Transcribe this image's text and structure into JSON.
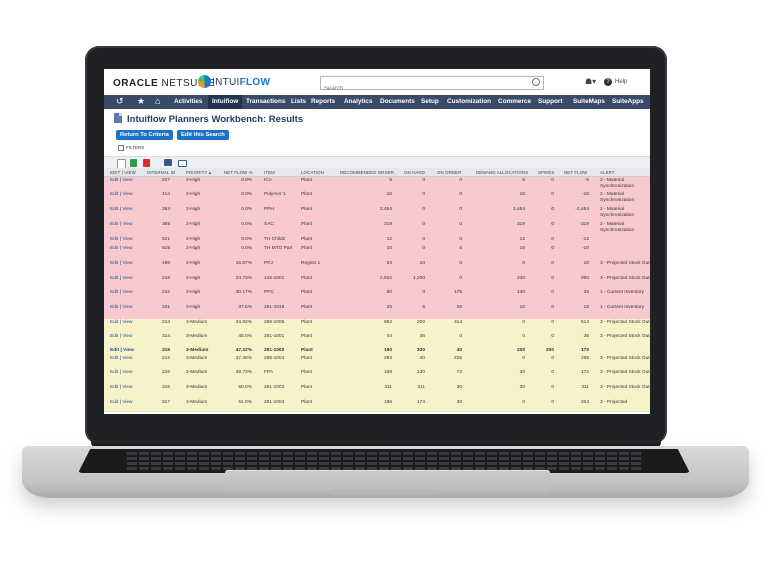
{
  "header": {
    "oracle_logo": "ORACLE",
    "netsuite_logo": "NETSUITE",
    "intuiflow_logo_a": "INTUI",
    "intuiflow_logo_b": "FLOW",
    "search_placeholder": "Search",
    "help_label": "Help"
  },
  "nav": {
    "items": [
      "Activities",
      "Intuiflow",
      "Transactions",
      "Lists",
      "Reports",
      "Analytics",
      "Documents",
      "Setup",
      "Customization",
      "Commerce",
      "Support",
      "SuiteMaps",
      "SuiteApps"
    ],
    "active": "Intuiflow"
  },
  "page": {
    "title": "Intuiflow Planners Workbench: Results",
    "return_button": "Return To Criteria",
    "edit_button": "Edit this Search",
    "filters_label": "FILTERS"
  },
  "table": {
    "columns": [
      "EDIT | VIEW",
      "INTERNAL ID",
      "PRIORITY ▴",
      "NET FLOW %",
      "ITEM",
      "LOCATION",
      "RECOMMENDED ORDER",
      "ON HAND",
      "ON ORDER",
      "DEMAND ALLOCATIONS",
      "SPIKES",
      "NET FLOW",
      "ALERT"
    ],
    "rows": [
      {
        "id": "227",
        "priority": "2-High",
        "nfp": "0.0%",
        "item": "ICA",
        "location": "Plant",
        "rec": "5",
        "onhand": "0",
        "onorder": "0",
        "demand": "5",
        "spikes": "0",
        "netflow": "-5",
        "alert": "2 - Material Synchronization",
        "color": "red",
        "bold": false,
        "h": 14
      },
      {
        "id": "414",
        "priority": "2-High",
        "nfp": "0.0%",
        "item": "Polymer 1",
        "location": "Plant",
        "rec": "10",
        "onhand": "0",
        "onorder": "0",
        "demand": "10",
        "spikes": "0",
        "netflow": "-10",
        "alert": "2 - Material Synchronization",
        "color": "red",
        "bold": false,
        "h": 15
      },
      {
        "id": "384",
        "priority": "2-High",
        "nfp": "0.0%",
        "item": "PPH",
        "location": "Plant",
        "rec": "2,464",
        "onhand": "0",
        "onorder": "0",
        "demand": "2,464",
        "spikes": "0",
        "netflow": "-2,464",
        "alert": "2 - Material Synchronization",
        "color": "red",
        "bold": false,
        "h": 15
      },
      {
        "id": "369",
        "priority": "2-High",
        "nfp": "0.0%",
        "item": "SAC",
        "location": "Plant",
        "rec": "319",
        "onhand": "0",
        "onorder": "0",
        "demand": "319",
        "spikes": "0",
        "netflow": "-319",
        "alert": "2 - Material Synchronization",
        "color": "red",
        "bold": false,
        "h": 15
      },
      {
        "id": "521",
        "priority": "2-High",
        "nfp": "0.0%",
        "item": "TH Child2",
        "location": "Plant",
        "rec": "12",
        "onhand": "0",
        "onorder": "0",
        "demand": "12",
        "spikes": "0",
        "netflow": "-12",
        "alert": "",
        "color": "red",
        "bold": false,
        "h": 9
      },
      {
        "id": "519",
        "priority": "2-High",
        "nfp": "0.0%",
        "item": "TH MTO Part",
        "location": "Plant",
        "rec": "10",
        "onhand": "0",
        "onorder": "6",
        "demand": "16",
        "spikes": "0",
        "netflow": "-10",
        "alert": "",
        "color": "red",
        "bold": false,
        "h": 15
      },
      {
        "id": "468",
        "priority": "2-High",
        "nfp": "15.67%",
        "item": "PPJ",
        "location": "Region 1",
        "rec": "53",
        "onhand": "10",
        "onorder": "0",
        "demand": "0",
        "spikes": "0",
        "netflow": "10",
        "alert": "3 - Projected Stock Out",
        "color": "red",
        "bold": false,
        "h": 15
      },
      {
        "id": "219",
        "priority": "2-High",
        "nfp": "24.73%",
        "item": "425-1001",
        "location": "Plant",
        "rec": "2,922",
        "onhand": "1,200",
        "onorder": "0",
        "demand": "240",
        "spikes": "0",
        "netflow": "960",
        "alert": "3 - Projected Stock Out",
        "color": "red",
        "bold": false,
        "h": 14
      },
      {
        "id": "242",
        "priority": "2-High",
        "nfp": "30.17%",
        "item": "PPC",
        "location": "Plant",
        "rec": "80",
        "onhand": "0",
        "onorder": "175",
        "demand": "140",
        "spikes": "0",
        "netflow": "35",
        "alert": "1 - Current Inventory",
        "color": "red",
        "bold": false,
        "h": 15
      },
      {
        "id": "331",
        "priority": "3-High",
        "nfp": "37.5%",
        "item": "261-1018",
        "location": "Plant",
        "rec": "25",
        "onhand": "5",
        "onorder": "26",
        "demand": "10",
        "spikes": "0",
        "netflow": "15",
        "alert": "1 - Current Inventory",
        "color": "red",
        "bold": false,
        "h": 15
      },
      {
        "id": "213",
        "priority": "3-Medium",
        "nfp": "34.82%",
        "item": "266-1005",
        "location": "Plant",
        "rec": "962",
        "onhand": "200",
        "onorder": "314",
        "demand": "0",
        "spikes": "0",
        "netflow": "514",
        "alert": "3 - Projected Stock Out",
        "color": "yellow",
        "bold": false,
        "h": 14
      },
      {
        "id": "314",
        "priority": "3-Medium",
        "nfp": "45.0%",
        "item": "261-1001",
        "location": "Plant",
        "rec": "44",
        "onhand": "36",
        "onorder": "0",
        "demand": "0",
        "spikes": "0",
        "netflow": "36",
        "alert": "3 - Projected Stock Out",
        "color": "yellow",
        "bold": false,
        "h": 14
      },
      {
        "id": "315",
        "priority": "3-Medium",
        "nfp": "47.22%",
        "item": "261-1002",
        "location": "Plant",
        "rec": "190",
        "onhand": "330",
        "onorder": "40",
        "demand": "200",
        "spikes": "200",
        "netflow": "170",
        "alert": "",
        "color": "yellow",
        "bold": true,
        "h": 8
      },
      {
        "id": "212",
        "priority": "3-Medium",
        "nfp": "47.49%",
        "item": "266-1004",
        "location": "Plant",
        "rec": "293",
        "onhand": "40",
        "onorder": "225",
        "demand": "0",
        "spikes": "0",
        "netflow": "265",
        "alert": "3 - Projected Stock Out",
        "color": "yellow",
        "bold": false,
        "h": 14
      },
      {
        "id": "226",
        "priority": "3-Medium",
        "nfp": "48.73%",
        "item": "FPA",
        "location": "Plant",
        "rec": "168",
        "onhand": "130",
        "onorder": "72",
        "demand": "30",
        "spikes": "0",
        "netflow": "172",
        "alert": "3 - Projected Stock Out",
        "color": "yellow",
        "bold": false,
        "h": 15
      },
      {
        "id": "316",
        "priority": "3-Medium",
        "nfp": "50.0%",
        "item": "261-1003",
        "location": "Plant",
        "rec": "311",
        "onhand": "311",
        "onorder": "30",
        "demand": "30",
        "spikes": "0",
        "netflow": "311",
        "alert": "3 - Projected Stock Out",
        "color": "yellow",
        "bold": false,
        "h": 15
      },
      {
        "id": "317",
        "priority": "3-Medium",
        "nfp": "51.0%",
        "item": "201-1004",
        "location": "Plant",
        "rec": "196",
        "onhand": "174",
        "onorder": "30",
        "demand": "0",
        "spikes": "0",
        "netflow": "204",
        "alert": "3 - Projected",
        "color": "yellow",
        "bold": false,
        "h": 12
      }
    ],
    "edit_label": "Edit",
    "view_label": "View"
  },
  "colors": {
    "nav": "#3b4a68",
    "red_row": "#f8c9cf",
    "yellow_row": "#f7f3c8",
    "button": "#1b73c9"
  }
}
